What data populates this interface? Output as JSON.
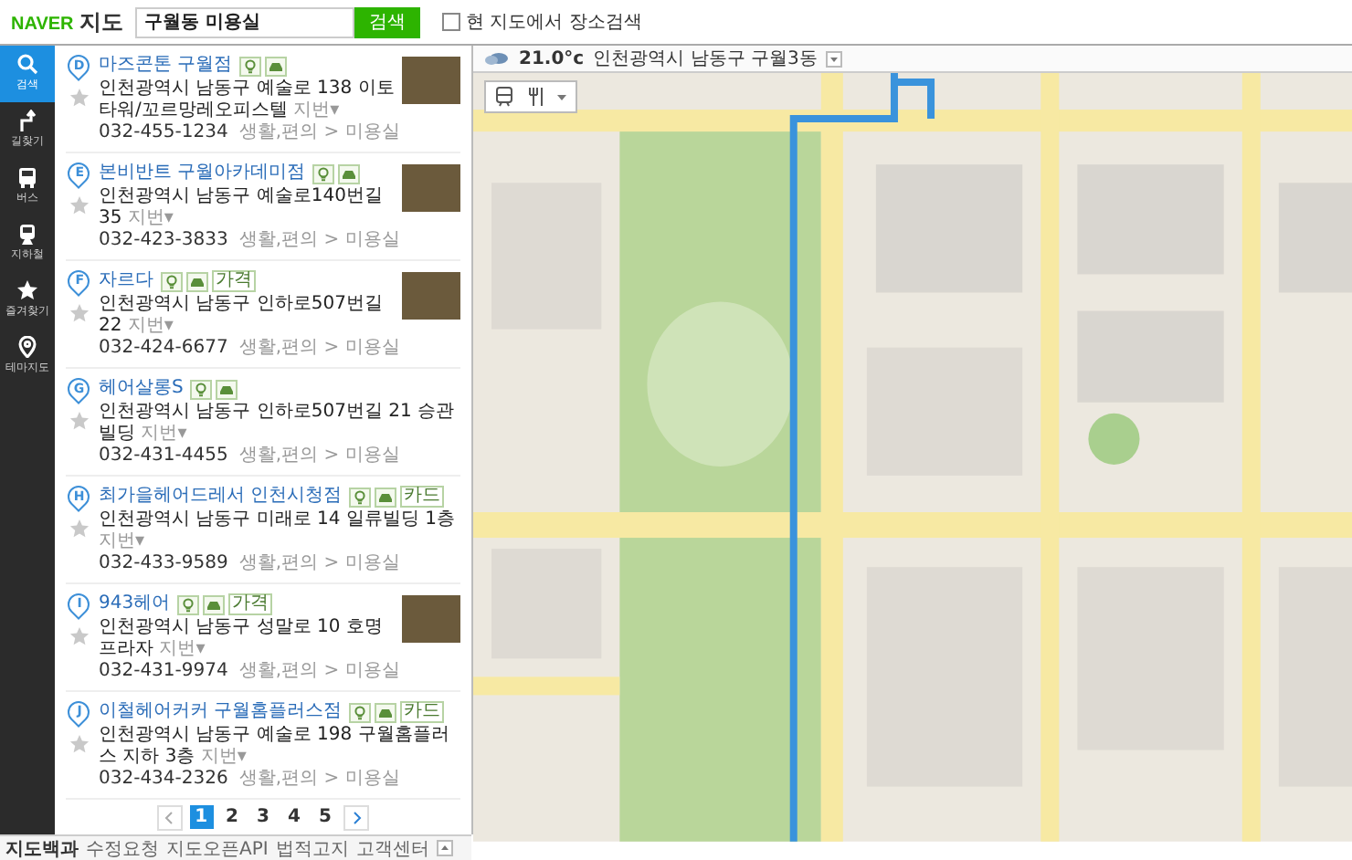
{
  "header": {
    "logo": {
      "brand": "NAVER",
      "product": "지도"
    },
    "search": {
      "value": "구월동 미용실"
    },
    "search_button": "검색",
    "area_search": {
      "label": "현 지도에서 장소검색",
      "checked": false
    }
  },
  "nav": [
    {
      "label": "검색",
      "kind": "search",
      "selected": true
    },
    {
      "label": "길찾기",
      "kind": "route",
      "selected": false
    },
    {
      "label": "버스",
      "kind": "bus",
      "selected": false
    },
    {
      "label": "지하철",
      "kind": "subway",
      "selected": false
    },
    {
      "label": "즐겨찾기",
      "kind": "star",
      "selected": false
    },
    {
      "label": "테마지도",
      "kind": "pin",
      "selected": false
    }
  ],
  "results": [
    {
      "marker": "D",
      "name": "마즈콘톤 구월점",
      "address": "인천광역시 남동구 예술로 138 이토타워/꼬르망레오피스텔",
      "lot": "지번▾",
      "phone": "032-455-1234",
      "category": "생활,편의 > 미용실",
      "photo": true
    },
    {
      "marker": "E",
      "name": "본비반트 구월아카데미점",
      "address": "인천광역시 남동구 예술로140번길 35",
      "lot": "지번▾",
      "phone": "032-423-3833",
      "category": "생활,편의 > 미용실",
      "photo": true
    },
    {
      "marker": "F",
      "name": "자르다",
      "tag": "가격",
      "address": "인천광역시 남동구 인하로507번길 22",
      "lot": "지번▾",
      "phone": "032-424-6677",
      "category": "생활,편의 > 미용실",
      "photo": true
    },
    {
      "marker": "G",
      "name": "헤어살롱S",
      "address": "인천광역시 남동구 인하로507번길 21 승관빌딩",
      "lot": "지번▾",
      "phone": "032-431-4455",
      "category": "생활,편의 > 미용실",
      "photo": false
    },
    {
      "marker": "H",
      "name": "최가을헤어드레서 인천시청점",
      "tag": "카드",
      "address": "인천광역시 남동구 미래로 14 일류빌딩 1층",
      "lot": "지번▾",
      "phone": "032-433-9589",
      "category": "생활,편의 > 미용실",
      "photo": false
    },
    {
      "marker": "I",
      "name": "943헤어",
      "tag": "가격",
      "address": "인천광역시 남동구 성말로 10 호명프라자",
      "lot": "지번▾",
      "phone": "032-431-9974",
      "category": "생활,편의 > 미용실",
      "photo": true
    },
    {
      "marker": "J",
      "name": "이철헤어커커 구월홈플러스점",
      "tag": "카드",
      "address": "인천광역시 남동구 예술로 198 구월홈플러스 지하 3층",
      "lot": "지번▾",
      "phone": "032-434-2326",
      "category": "생활,편의 > 미용실",
      "photo": false
    }
  ],
  "pagination": [
    {
      "label": "1",
      "selected": true
    },
    {
      "label": "2",
      "selected": false
    },
    {
      "label": "3",
      "selected": false
    },
    {
      "label": "4",
      "selected": false
    },
    {
      "label": "5",
      "selected": false
    }
  ],
  "footer": [
    "지도백과",
    "수정요청",
    "지도오픈API",
    "법적고지",
    "고객센터"
  ],
  "map": {
    "weather": {
      "temp": "21.0°c",
      "location": "인천광역시 남동구 구월3동"
    }
  }
}
